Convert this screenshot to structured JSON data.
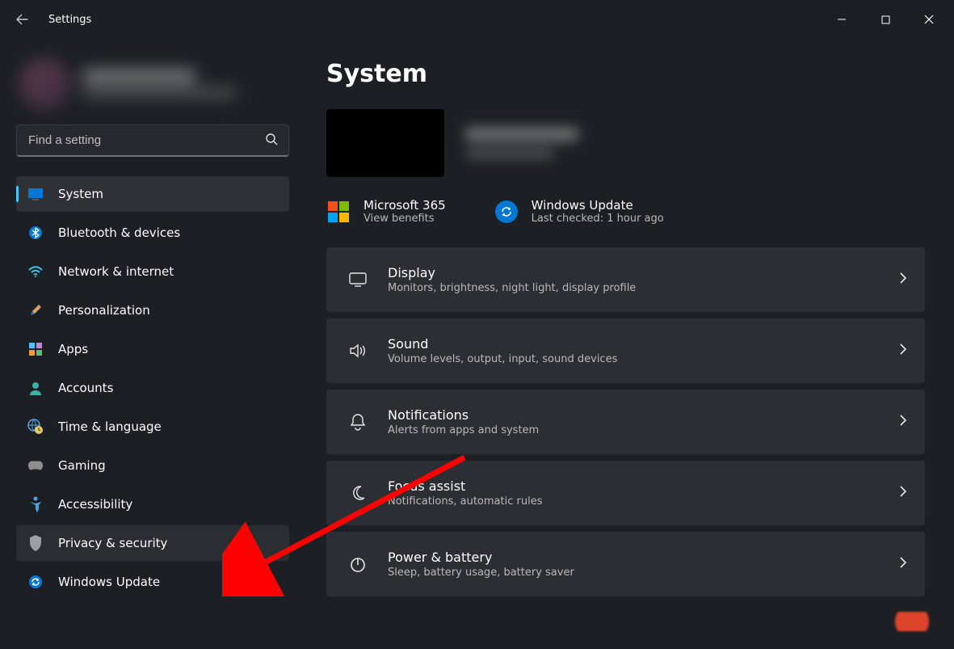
{
  "app_title": "Settings",
  "search": {
    "placeholder": "Find a setting"
  },
  "sidebar": {
    "items": [
      {
        "label": "System",
        "icon": "monitor-icon",
        "selected": true
      },
      {
        "label": "Bluetooth & devices",
        "icon": "bluetooth-icon"
      },
      {
        "label": "Network & internet",
        "icon": "wifi-icon"
      },
      {
        "label": "Personalization",
        "icon": "brush-icon"
      },
      {
        "label": "Apps",
        "icon": "apps-icon"
      },
      {
        "label": "Accounts",
        "icon": "person-icon"
      },
      {
        "label": "Time & language",
        "icon": "globe-clock-icon"
      },
      {
        "label": "Gaming",
        "icon": "gamepad-icon"
      },
      {
        "label": "Accessibility",
        "icon": "accessibility-icon"
      },
      {
        "label": "Privacy & security",
        "icon": "shield-icon",
        "hover": true
      },
      {
        "label": "Windows Update",
        "icon": "update-icon"
      }
    ]
  },
  "page": {
    "title": "System",
    "quick": [
      {
        "title": "Microsoft 365",
        "sub": "View benefits"
      },
      {
        "title": "Windows Update",
        "sub": "Last checked: 1 hour ago"
      }
    ],
    "settings": [
      {
        "title": "Display",
        "sub": "Monitors, brightness, night light, display profile",
        "icon": "display-icon"
      },
      {
        "title": "Sound",
        "sub": "Volume levels, output, input, sound devices",
        "icon": "sound-icon"
      },
      {
        "title": "Notifications",
        "sub": "Alerts from apps and system",
        "icon": "bell-icon"
      },
      {
        "title": "Focus assist",
        "sub": "Notifications, automatic rules",
        "icon": "moon-icon"
      },
      {
        "title": "Power & battery",
        "sub": "Sleep, battery usage, battery saver",
        "icon": "power-icon"
      }
    ]
  }
}
